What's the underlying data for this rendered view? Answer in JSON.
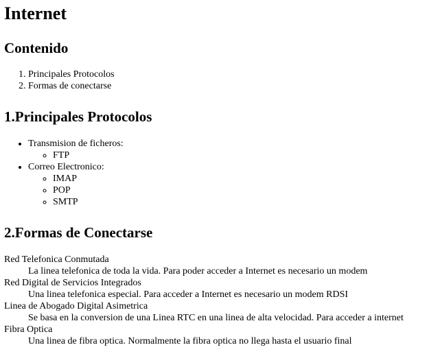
{
  "title": "Internet",
  "contents": {
    "heading": "Contenido",
    "items": [
      "Principales Protocolos",
      "Formas de conectarse"
    ]
  },
  "protocols": {
    "heading": "1.Principales Protocolos",
    "groups": [
      {
        "label": "Transmision de ficheros:",
        "items": [
          "FTP"
        ]
      },
      {
        "label": "Correo Electronico:",
        "items": [
          "IMAP",
          "POP",
          "SMTP"
        ]
      }
    ]
  },
  "connections": {
    "heading": "2.Formas de Conectarse",
    "entries": [
      {
        "term": "Red Telefonica Conmutada",
        "desc": "La linea telefonica de toda la vida. Para poder acceder a Internet es necesario un modem"
      },
      {
        "term": "Red Digital de Servicios Integrados",
        "desc": "Una linea telefonica especial. Para acceder a Internet es necesario un modem RDSI"
      },
      {
        "term": "Linea de Abogado Digital Asimetrica",
        "desc": "Se basa en la conversion de una Linea RTC en una linea de alta velocidad. Para acceder a internet"
      },
      {
        "term": "Fibra Optica",
        "desc": "Una linea de fibra optica. Normalmente la fibra optica no llega hasta el usuario final"
      }
    ]
  }
}
